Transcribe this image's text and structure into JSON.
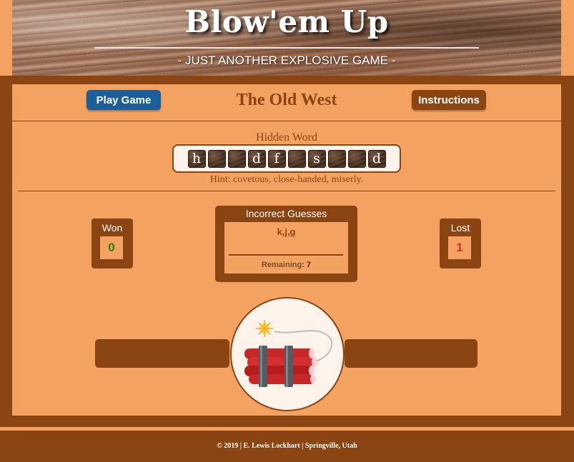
{
  "header": {
    "title": "Blow'em Up",
    "subtitle": "- JUST ANOTHER EXPLOSIVE GAME -"
  },
  "controls": {
    "play_label": "Play Game",
    "instructions_label": "Instructions"
  },
  "level": {
    "title": "The Old West"
  },
  "hidden_word": {
    "label": "Hidden Word",
    "tiles": [
      "h",
      "",
      "",
      "d",
      "f",
      "",
      "s",
      "",
      "",
      "d"
    ],
    "hint": "Hint: covetous, close-handed, miserly."
  },
  "scores": {
    "won_label": "Won",
    "won_value": "0",
    "lost_label": "Lost",
    "lost_value": "1"
  },
  "guesses": {
    "title": "Incorrect Guesses",
    "letters": "k,j,g",
    "remaining_label": "Remaining:",
    "remaining_value": "7"
  },
  "footer": {
    "text": "© 2019 | E. Lewis Lockhart | Springville, Utah"
  },
  "colors": {
    "background": "#f4a261",
    "frame": "#8b4513",
    "play_button": "#1b5e9a",
    "won": "#2e7d1a",
    "lost": "#d32f2f"
  },
  "icons": {
    "bomb": "dynamite-icon"
  }
}
